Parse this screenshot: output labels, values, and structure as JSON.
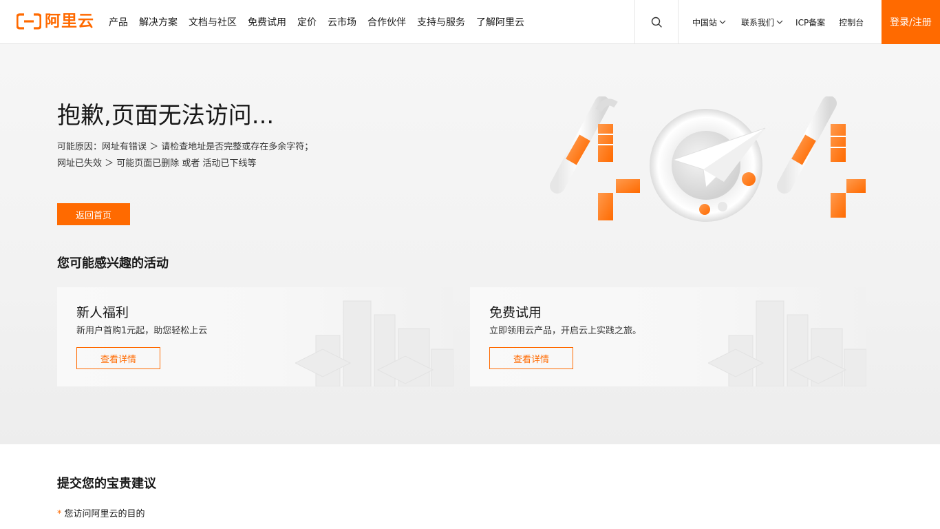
{
  "header": {
    "logo_text": "阿里云",
    "nav": [
      "产品",
      "解决方案",
      "文档与社区",
      "免费试用",
      "定价",
      "云市场",
      "合作伙伴",
      "支持与服务",
      "了解阿里云"
    ],
    "right_nav": {
      "site": "中国站",
      "contact": "联系我们",
      "icp": "ICP备案",
      "console": "控制台"
    },
    "login": "登录/注册"
  },
  "hero": {
    "title": "抱歉,页面无法访问...",
    "reason": "可能原因：网址有错误 ＞ 请检查地址是否完整或存在多余字符；网址已失效 ＞ 可能页面已删除 或者 活动已下线等",
    "home_button": "返回首页",
    "art_text": "404"
  },
  "activities": {
    "title": "您可能感兴趣的活动",
    "cards": [
      {
        "title": "新人福利",
        "desc": "新用户首购1元起，助您轻松上云",
        "button": "查看详情"
      },
      {
        "title": "免费试用",
        "desc": "立即领用云产品，开启云上实践之旅。",
        "button": "查看详情"
      }
    ]
  },
  "suggest": {
    "title": "提交您的宝贵建议",
    "required_mark": "*",
    "field_label": "您访问阿里云的目的"
  },
  "colors": {
    "brand": "#ff6a00",
    "text": "#181818",
    "hero_bg": "#f4f4f4"
  }
}
